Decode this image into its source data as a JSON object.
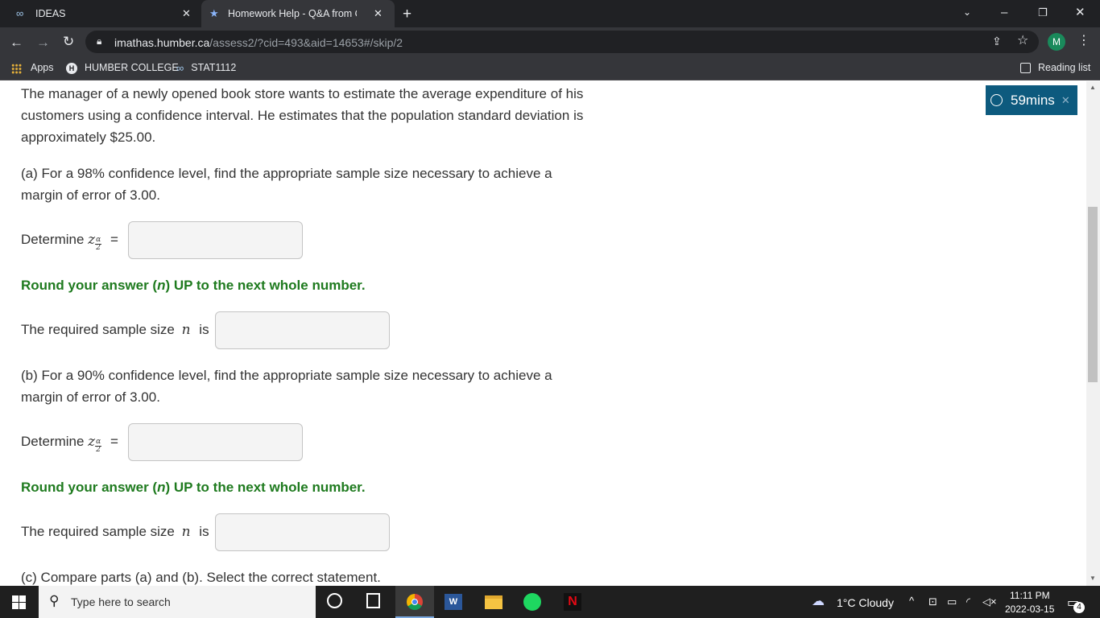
{
  "browser": {
    "tabs": [
      {
        "label": "IDEAS",
        "icon": "infinity-icon"
      },
      {
        "label": "Homework Help - Q&A from Onl",
        "icon": "star-icon"
      }
    ],
    "url_domain": "imathas.humber.ca",
    "url_path": "/assess2/?cid=493&aid=14653#/skip/2",
    "profile_initial": "M",
    "bookmarks": [
      {
        "label": "Apps"
      },
      {
        "label": "HUMBER COLLEGE"
      },
      {
        "label": "STAT1112"
      }
    ],
    "reading_list": "Reading list"
  },
  "question": {
    "intro": "The manager of a newly opened book store wants to estimate the average expenditure of his customers using a confidence interval. He estimates that the population standard deviation is approximately $25.00.",
    "part_a": "(a) For a 98% confidence level, find the appropriate sample size necessary to achieve a margin of error of 3.00.",
    "part_b": "(b) For a 90% confidence level, find the appropriate sample size necessary to achieve a margin of error of 3.00.",
    "part_c": "(c) Compare parts (a) and (b). Select the correct statement.",
    "determine_label": "Determine",
    "z_symbol": "z",
    "frac_num": "α",
    "frac_den": "2",
    "equals": "=",
    "round_note": "Round your answer (n) UP to the next whole number.",
    "round_pre": "Round your answer (",
    "round_n": "n",
    "round_post": ") UP to the next whole number.",
    "sample_label_pre": "The required sample size",
    "sample_n": "n",
    "sample_label_post": "is",
    "answer_a_z": "",
    "answer_a_n": "",
    "answer_b_z": "",
    "answer_b_n": ""
  },
  "timer": {
    "label": "59mins"
  },
  "taskbar": {
    "search_placeholder": "Type here to search",
    "weather": "1°C  Cloudy",
    "time": "11:11 PM",
    "date": "2022-03-15",
    "notification_count": "4"
  }
}
